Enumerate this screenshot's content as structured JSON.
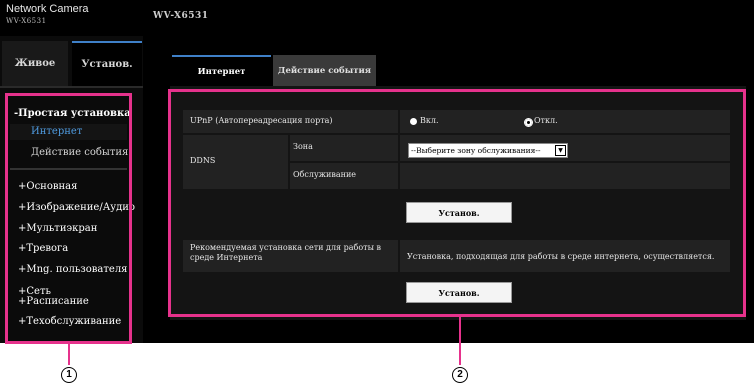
{
  "header": {
    "brand": "Network Camera",
    "model_small": "WV-X6531",
    "model_title": "WV-X6531"
  },
  "tabs": {
    "live": "Живое",
    "setup": "Установ."
  },
  "sidebar": {
    "section_title": "-Простая установка",
    "sub_items": [
      "Интернет",
      "Действие события"
    ],
    "items": [
      "+Основная",
      "+Изображение/Аудио",
      "+Мультиэкран",
      "+Тревога",
      "+Mng. пользователя",
      "+Сеть",
      "+Расписание",
      "+Техобслуживание"
    ]
  },
  "main": {
    "tabs": [
      "Интернет",
      "Действие события"
    ],
    "upnp": {
      "label": "UPnP (Автопереадресация порта)",
      "on": "Вкл.",
      "off": "Откл.",
      "selected": "off"
    },
    "ddns": {
      "label": "DDNS",
      "zone_label": "Зона",
      "zone_value": "--Выберите зону обслуживания--",
      "service_label": "Обслуживание"
    },
    "set_button_1": "Установ.",
    "recommended": {
      "label": "Рекомендуемая установка сети для работы в среде Интернета",
      "description": "Установка, подходящая для работы в среде интернета, осуществляется."
    },
    "set_button_2": "Установ."
  },
  "callouts": [
    "1",
    "2"
  ],
  "colors": {
    "callout": "#e6328c",
    "active_tab_accent": "#3f80c8",
    "active_nav": "#4f9be0"
  }
}
